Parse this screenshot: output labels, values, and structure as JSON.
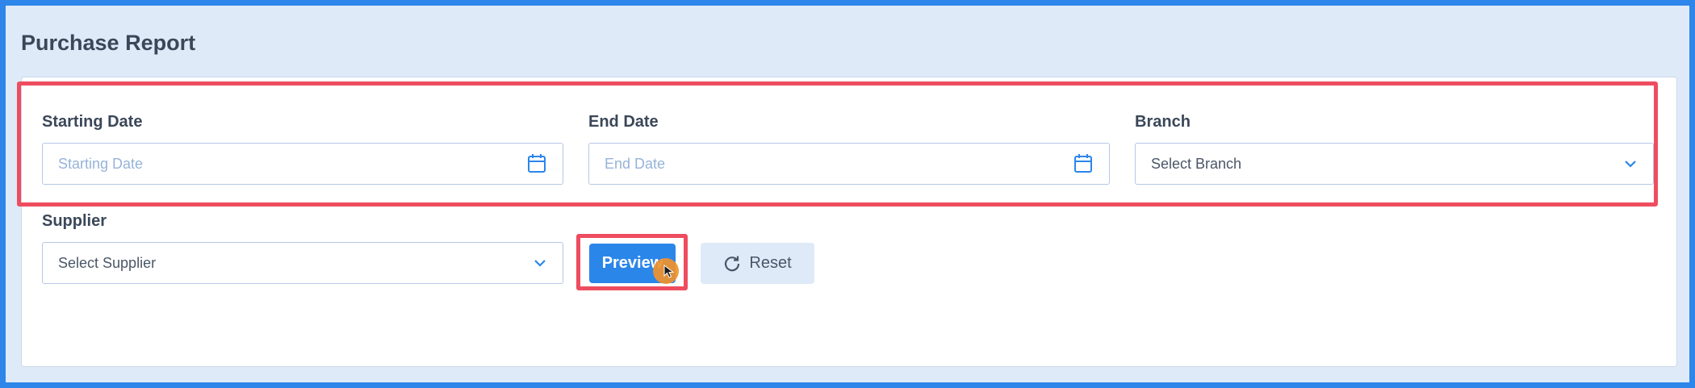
{
  "page": {
    "title": "Purchase Report"
  },
  "filters": {
    "starting_date": {
      "label": "Starting Date",
      "placeholder": "Starting Date",
      "value": ""
    },
    "end_date": {
      "label": "End Date",
      "placeholder": "End Date",
      "value": ""
    },
    "branch": {
      "label": "Branch",
      "selected": "Select Branch"
    },
    "supplier": {
      "label": "Supplier",
      "selected": "Select Supplier"
    }
  },
  "actions": {
    "preview_label": "Preview",
    "reset_label": "Reset"
  },
  "icons": {
    "date": "calendar-icon",
    "select": "chevron-down-icon",
    "reset": "refresh-icon"
  },
  "colors": {
    "accent": "#2b86ea",
    "highlight": "#ee4d5f",
    "cursor": "#f0922b",
    "panel_bg": "#dfeaf8"
  }
}
